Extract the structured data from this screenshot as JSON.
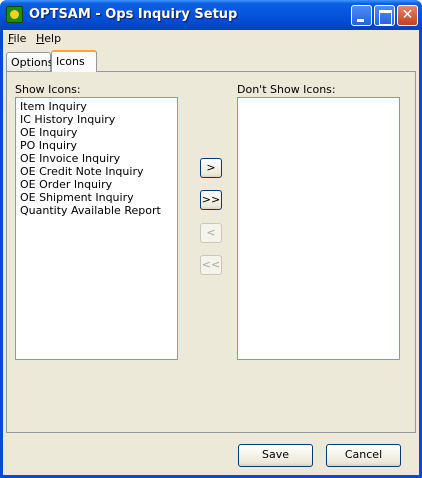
{
  "window": {
    "title": "OPTSAM - Ops Inquiry Setup"
  },
  "menu": {
    "file_label": "File",
    "file_key": "F",
    "file_rest": "ile",
    "help_label": "Help",
    "help_key": "H",
    "help_rest": "elp"
  },
  "tabs": [
    {
      "label": "Options"
    },
    {
      "label": "Icons"
    }
  ],
  "show_icons": {
    "label": "Show Icons:",
    "items": [
      "Item Inquiry",
      "IC History Inquiry",
      "OE Inquiry",
      "PO Inquiry",
      "OE Invoice Inquiry",
      "OE Credit Note Inquiry",
      "OE Order Inquiry",
      "OE Shipment Inquiry",
      "Quantity Available Report"
    ]
  },
  "dont_show_icons": {
    "label": "Don't Show Icons:",
    "items": []
  },
  "move_buttons": {
    "move_one_right": ">",
    "move_all_right": ">>",
    "move_one_left": "<",
    "move_all_left": "<<"
  },
  "buttons": {
    "save": "Save",
    "cancel": "Cancel"
  }
}
